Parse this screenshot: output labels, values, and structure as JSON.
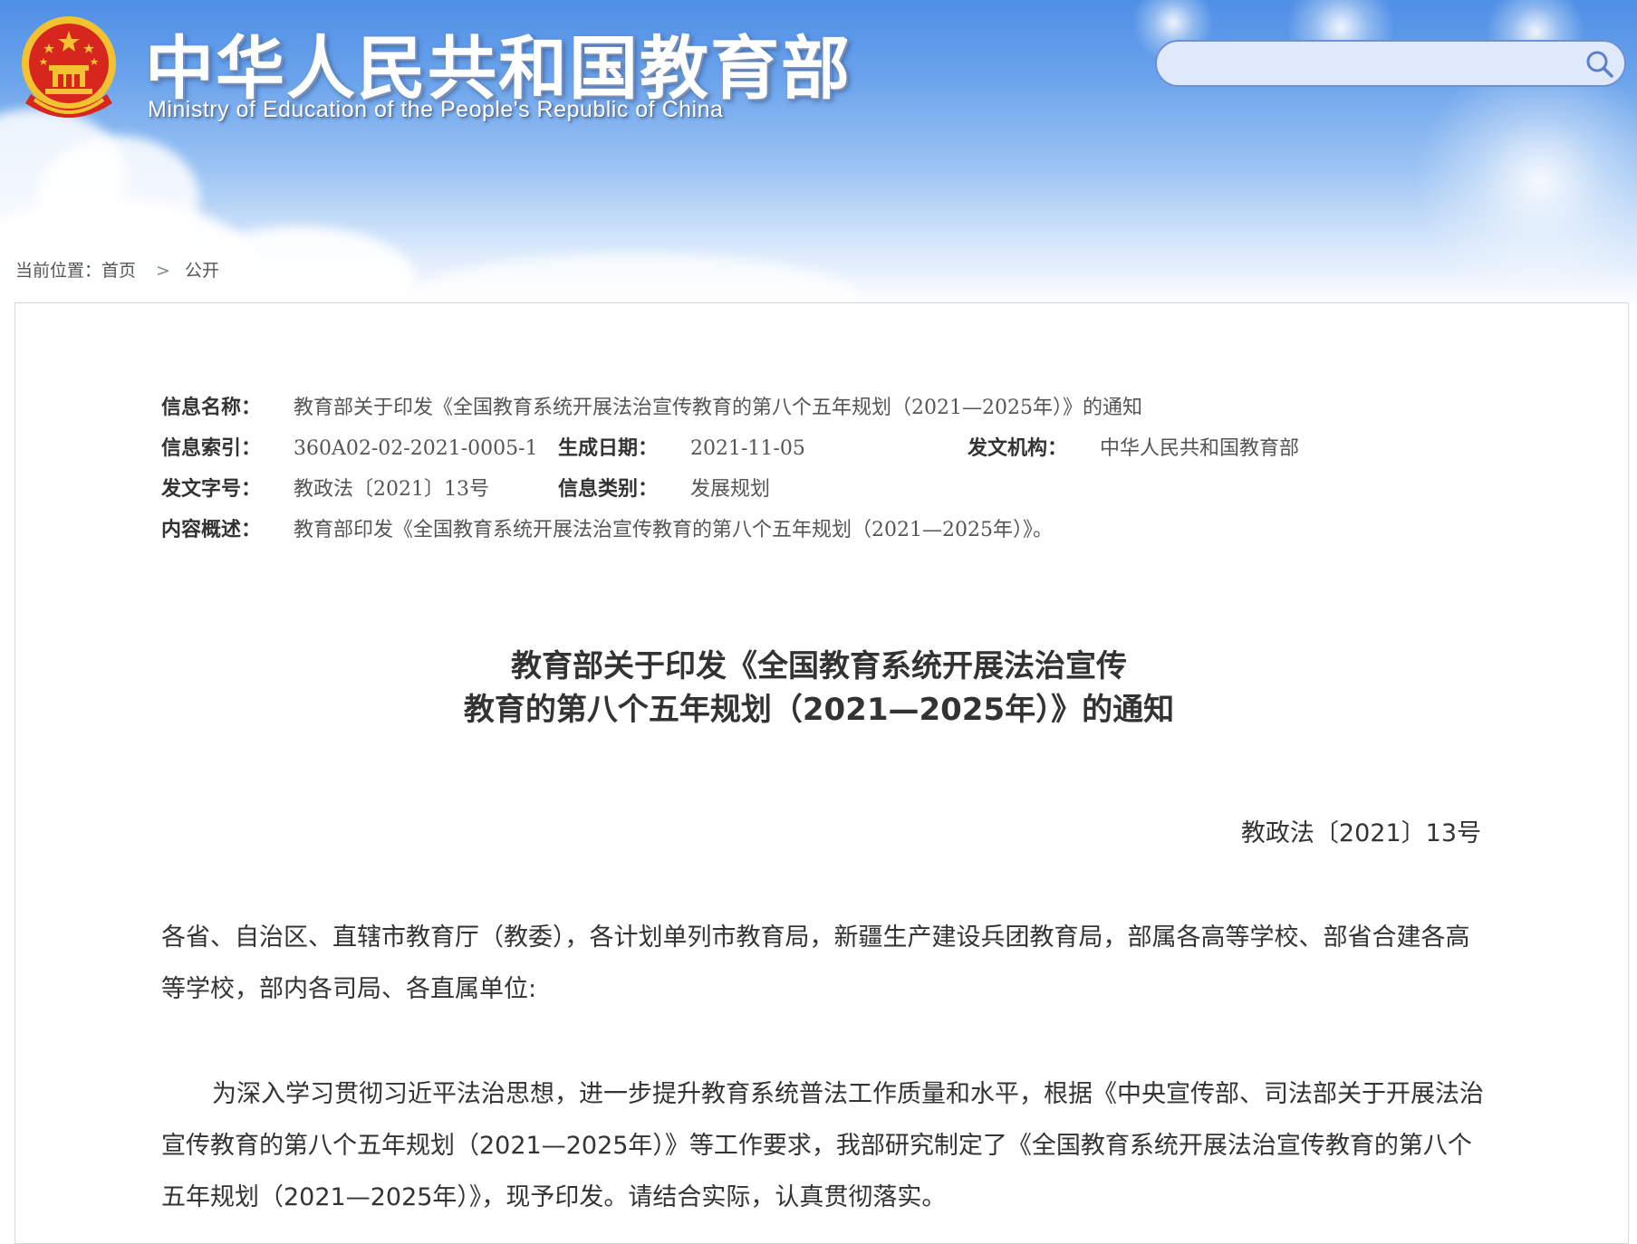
{
  "site": {
    "title": "中华人民共和国教育部",
    "subtitle": "Ministry of Education of the People's Republic of China"
  },
  "search": {
    "placeholder": "",
    "value": "",
    "icon": "search-icon"
  },
  "breadcrumb": {
    "prefix": "当前位置：",
    "home": "首页",
    "separator": ">",
    "current": "公开"
  },
  "meta": {
    "name_label": "信息名称：",
    "name_value": "教育部关于印发《全国教育系统开展法治宣传教育的第八个五年规划（2021—2025年）》的通知",
    "index_label": "信息索引：",
    "index_value": "360A02-02-2021-0005-1",
    "date_label": "生成日期：",
    "date_value": "2021-11-05",
    "issuer_label": "发文机构：",
    "issuer_value": "中华人民共和国教育部",
    "docno_label": "发文字号：",
    "docno_value": "教政法〔2021〕13号",
    "category_label": "信息类别：",
    "category_value": "发展规划",
    "summary_label": "内容概述：",
    "summary_value": "教育部印发《全国教育系统开展法治宣传教育的第八个五年规划（2021—2025年）》。"
  },
  "document": {
    "title_line1": "教育部关于印发《全国教育系统开展法治宣传",
    "title_line2": "教育的第八个五年规划（2021—2025年）》的通知",
    "number": "教政法〔2021〕13号",
    "paragraphs": [
      "各省、自治区、直辖市教育厅（教委），各计划单列市教育局，新疆生产建设兵团教育局，部属各高等学校、部省合建各高等学校，部内各司局、各直属单位:",
      "为深入学习贯彻习近平法治思想，进一步提升教育系统普法工作质量和水平，根据《中央宣传部、司法部关于开展法治宣传教育的第八个五年规划（2021—2025年）》等工作要求，我部研究制定了《全国教育系统开展法治宣传教育的第八个五年规划（2021—2025年）》，现予印发。请结合实际，认真贯彻落实。"
    ]
  },
  "colors": {
    "header_blue": "#4f8fe6",
    "emblem_red": "#d7261e",
    "emblem_gold": "#f2c230",
    "text_dark": "#333333"
  }
}
